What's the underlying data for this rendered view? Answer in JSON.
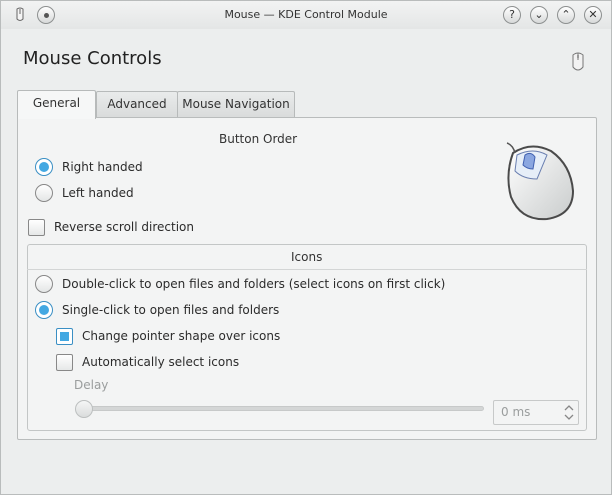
{
  "window": {
    "title": "Mouse — KDE Control Module",
    "buttons": {
      "help": "?",
      "minimize": "⌄",
      "maximize": "⌃",
      "close": "✕"
    }
  },
  "header": {
    "title": "Mouse Controls"
  },
  "tabs": [
    {
      "label": "General",
      "active": true
    },
    {
      "label": "Advanced",
      "active": false
    },
    {
      "label": "Mouse Navigation",
      "active": false
    }
  ],
  "button_order": {
    "title": "Button Order",
    "right_handed": "Right handed",
    "left_handed": "Left handed",
    "selected": "right_handed"
  },
  "reverse_scroll": {
    "label": "Reverse scroll direction",
    "checked": false
  },
  "icons": {
    "title": "Icons",
    "double_click": "Double-click to open files and folders (select icons on first click)",
    "single_click": "Single-click to open files and folders",
    "selected": "single_click",
    "change_pointer": {
      "label": "Change pointer shape over icons",
      "checked": true
    },
    "auto_select": {
      "label": "Automatically select icons",
      "checked": false
    },
    "delay": {
      "label": "Delay",
      "value": "0 ms"
    }
  },
  "colors": {
    "accent": "#43a8e2"
  }
}
